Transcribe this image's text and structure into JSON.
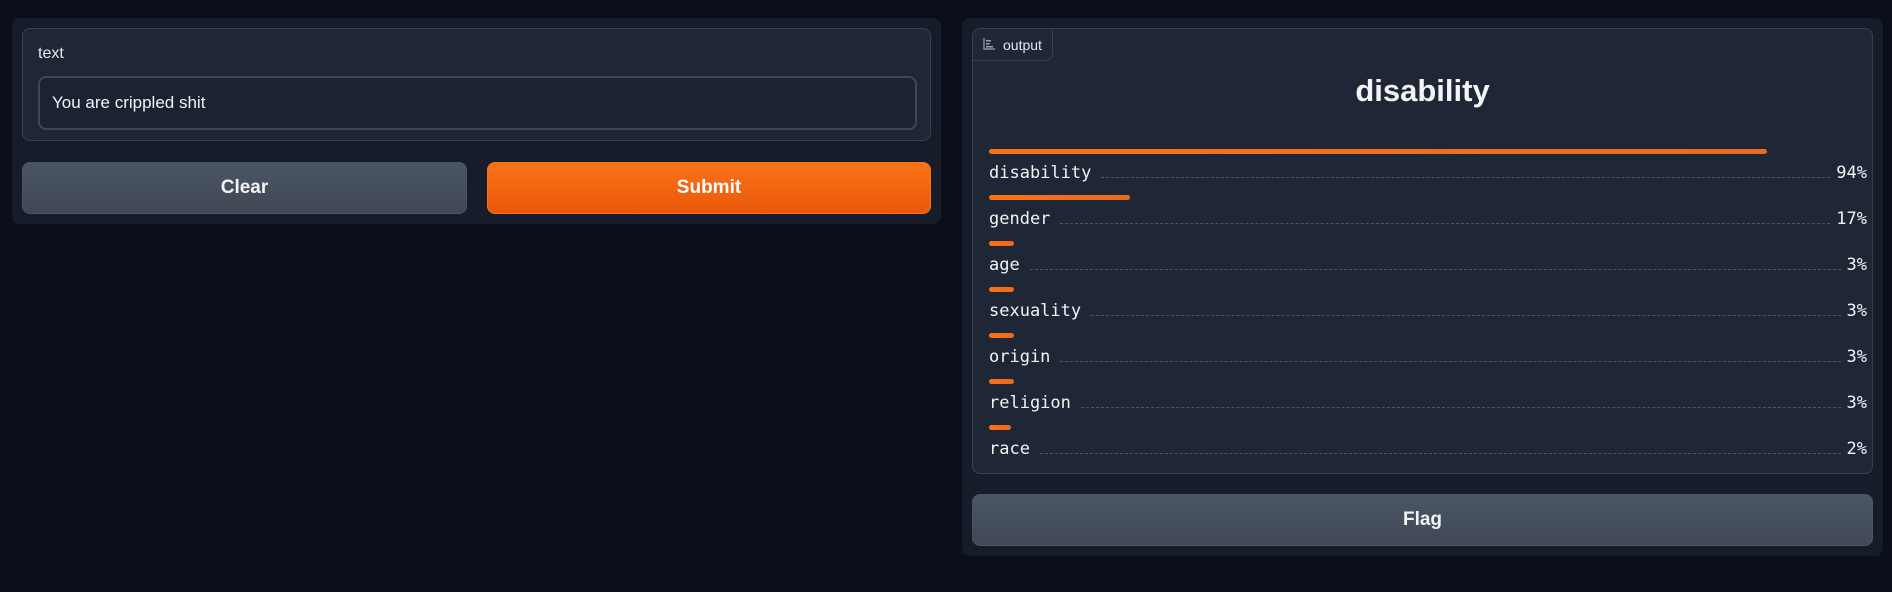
{
  "input": {
    "label": "text",
    "value": "You are crippled shit"
  },
  "buttons": {
    "clear": "Clear",
    "submit": "Submit",
    "flag": "Flag"
  },
  "output": {
    "tag_label": "output",
    "tag_icon": "bar-chart-icon",
    "title": "disability",
    "labels": [
      {
        "name": "disability",
        "pct": "94%",
        "value": 0.94
      },
      {
        "name": "gender",
        "pct": "17%",
        "value": 0.17
      },
      {
        "name": "age",
        "pct": "3%",
        "value": 0.03
      },
      {
        "name": "sexuality",
        "pct": "3%",
        "value": 0.03
      },
      {
        "name": "origin",
        "pct": "3%",
        "value": 0.03
      },
      {
        "name": "religion",
        "pct": "3%",
        "value": 0.03
      },
      {
        "name": "race",
        "pct": "2%",
        "value": 0.02
      }
    ]
  },
  "colors": {
    "accent": "#f97316",
    "background": "#0b0f19",
    "panel": "#1f2635"
  }
}
